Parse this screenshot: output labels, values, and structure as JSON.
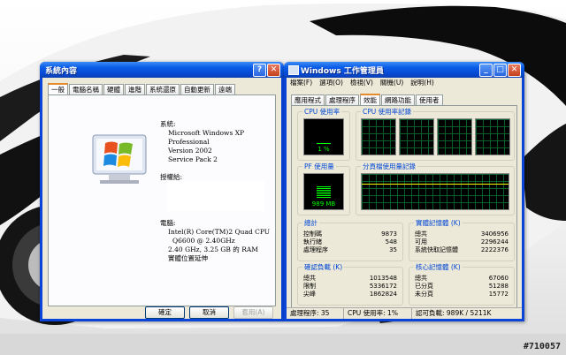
{
  "watermark": "#710057",
  "sysprops": {
    "title": "系統內容",
    "help_btn": "?",
    "close_btn": "✕",
    "tabs": [
      {
        "label": "一般"
      },
      {
        "label": "電腦名稱"
      },
      {
        "label": "硬體"
      },
      {
        "label": "進階"
      },
      {
        "label": "系統還原"
      },
      {
        "label": "自動更新"
      },
      {
        "label": "遠端"
      }
    ],
    "system_heading": "系統:",
    "os_lines": [
      "Microsoft Windows XP",
      "Professional",
      "Version 2002",
      "Service Pack 2"
    ],
    "registered_heading": "授權給:",
    "computer_heading": "電腦:",
    "computer_lines": [
      "Intel(R) Core(TM)2 Quad CPU",
      "Q6600  @ 2.40GHz",
      "2.40 GHz, 3.25 GB 的 RAM",
      "實體位置延伸"
    ],
    "buttons": {
      "ok": "確定",
      "cancel": "取消",
      "apply": "套用(A)"
    }
  },
  "taskmgr": {
    "title": "Windows 工作管理員",
    "menu": [
      "檔案(F)",
      "選項(O)",
      "檢視(V)",
      "關機(U)",
      "說明(H)"
    ],
    "tabs": [
      {
        "label": "應用程式"
      },
      {
        "label": "處理程序"
      },
      {
        "label": "效能"
      },
      {
        "label": "網路功能"
      },
      {
        "label": "使用者"
      }
    ],
    "cpu_usage": {
      "label": "CPU 使用率",
      "value": "1 %",
      "percent": 1
    },
    "cpu_history": {
      "label": "CPU 使用率記錄"
    },
    "pf_usage": {
      "label": "PF 使用量",
      "value": "989 MB"
    },
    "pf_history": {
      "label": "分頁檔使用量記錄"
    },
    "totals": {
      "label": "總計",
      "rows": [
        {
          "name": "控制碼",
          "value": "9873"
        },
        {
          "name": "執行緒",
          "value": "548"
        },
        {
          "name": "處理程序",
          "value": "35"
        }
      ]
    },
    "physical": {
      "label": "實體記憶體 (K)",
      "rows": [
        {
          "name": "總共",
          "value": "3406956"
        },
        {
          "name": "可用",
          "value": "2296244"
        },
        {
          "name": "系統快取記憶體",
          "value": "2222376"
        }
      ]
    },
    "commit": {
      "label": "確認負載 (K)",
      "rows": [
        {
          "name": "總共",
          "value": "1013548"
        },
        {
          "name": "限制",
          "value": "5336172"
        },
        {
          "name": "尖峰",
          "value": "1862824"
        }
      ]
    },
    "kernel": {
      "label": "核心記憶體 (K)",
      "rows": [
        {
          "name": "總共",
          "value": "67060"
        },
        {
          "name": "已分頁",
          "value": "51288"
        },
        {
          "name": "未分頁",
          "value": "15772"
        }
      ]
    },
    "status": {
      "processes": "處理程序: 35",
      "cpu": "CPU 使用率: 1%",
      "commit": "認可負載: 989K / 5211K"
    }
  }
}
